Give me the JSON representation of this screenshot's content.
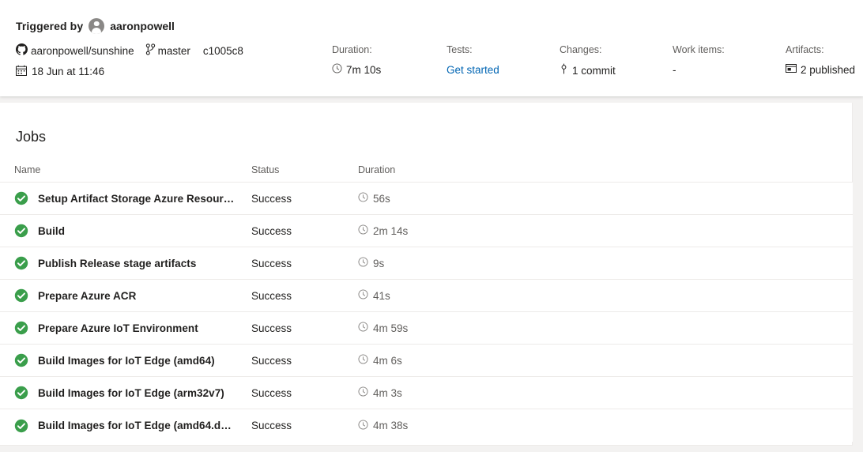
{
  "header": {
    "triggered_by_label": "Triggered by",
    "user": "aaronpowell",
    "avatar_icon": "person-avatar-icon",
    "repo_icon": "github-icon",
    "repo": "aaronpowell/sunshine",
    "branch_icon": "branch-icon",
    "branch": "master",
    "commit_sha": "c1005c8",
    "calendar_icon": "calendar-icon",
    "date": "18 Jun at 11:46",
    "meta": {
      "duration": {
        "label": "Duration:",
        "value": "7m 10s",
        "icon": "clock-icon"
      },
      "tests": {
        "label": "Tests:",
        "value": "Get started",
        "icon": "",
        "link_color": "#0065b3"
      },
      "changes": {
        "label": "Changes:",
        "value": "1 commit",
        "icon": "commit-icon"
      },
      "work_items": {
        "label": "Work items:",
        "value": "-",
        "icon": ""
      },
      "artifacts": {
        "label": "Artifacts:",
        "value": "2 published",
        "icon": "artifact-icon"
      }
    }
  },
  "jobs": {
    "title": "Jobs",
    "columns": {
      "name": "Name",
      "status": "Status",
      "duration": "Duration"
    },
    "status_icon": "success-check-icon",
    "duration_icon": "clock-icon",
    "success_color": "#3a9e4b",
    "rows": [
      {
        "name": "Setup Artifact Storage Azure Resour…",
        "status": "Success",
        "duration": "56s"
      },
      {
        "name": "Build",
        "status": "Success",
        "duration": "2m 14s"
      },
      {
        "name": "Publish Release stage artifacts",
        "status": "Success",
        "duration": "9s"
      },
      {
        "name": "Prepare Azure ACR",
        "status": "Success",
        "duration": "41s"
      },
      {
        "name": "Prepare Azure IoT Environment",
        "status": "Success",
        "duration": "4m 59s"
      },
      {
        "name": "Build Images for IoT Edge (amd64)",
        "status": "Success",
        "duration": "4m 6s"
      },
      {
        "name": "Build Images for IoT Edge (arm32v7)",
        "status": "Success",
        "duration": "4m 3s"
      },
      {
        "name": "Build Images for IoT Edge (amd64.d…",
        "status": "Success",
        "duration": "4m 38s"
      }
    ]
  }
}
